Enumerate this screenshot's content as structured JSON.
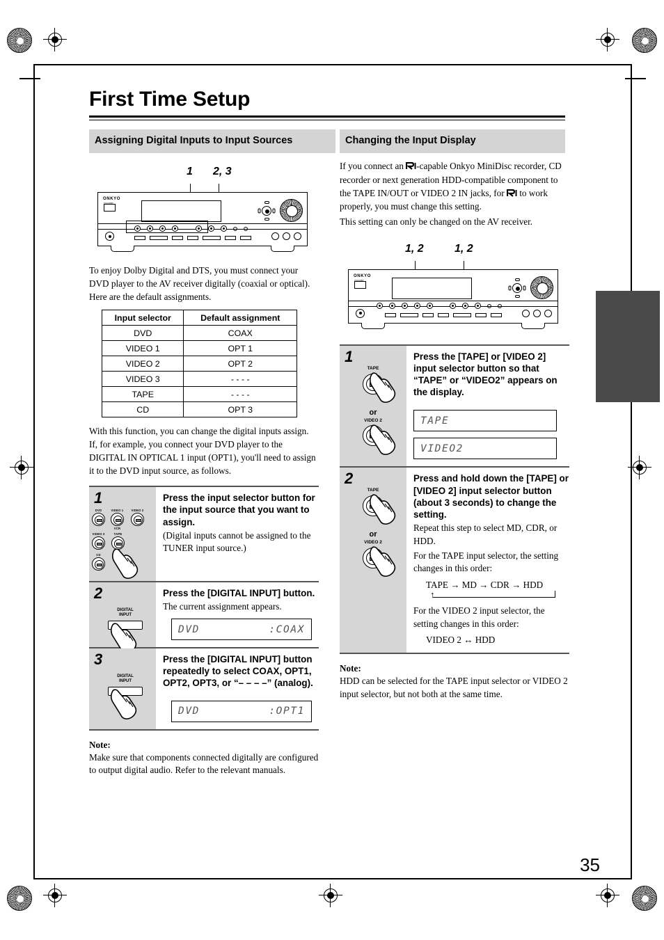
{
  "page": {
    "title": "First Time Setup",
    "page_number": "35"
  },
  "left_column": {
    "section_heading": "Assigning Digital Inputs to Input Sources",
    "diagram_callouts": [
      "1",
      "2, 3"
    ],
    "receiver_brand": "ONKYO",
    "intro_paragraph_1": "To enjoy Dolby Digital and DTS, you must connect your DVD player to the AV receiver digitally (coaxial or optical).",
    "intro_paragraph_2": "Here are the default assignments.",
    "table": {
      "headers": [
        "Input selector",
        "Default assignment"
      ],
      "rows": [
        [
          "DVD",
          "COAX"
        ],
        [
          "VIDEO 1",
          "OPT 1"
        ],
        [
          "VIDEO 2",
          "OPT 2"
        ],
        [
          "VIDEO 3",
          "- - - -"
        ],
        [
          "TAPE",
          "- - - -"
        ],
        [
          "CD",
          "OPT 3"
        ]
      ]
    },
    "after_table_paragraph": "With this function, you can change the digital inputs assign. If, for example, you connect your DVD player to the DIGITAL IN OPTICAL 1 input (OPT1), you'll need to assign it to the DVD input source, as follows.",
    "steps": [
      {
        "number": "1",
        "title": "Press the input selector button for the input source that you want to assign.",
        "description": "(Digital inputs cannot be assigned to the TUNER input source.)",
        "button_labels": [
          "DVD",
          "VIDEO 1",
          "VIDEO 2",
          "VCR",
          "VIDEO 3",
          "TAPE",
          "CD"
        ]
      },
      {
        "number": "2",
        "title": "Press the [DIGITAL INPUT] button.",
        "description": "The current assignment appears.",
        "button_label_line1": "DIGITAL",
        "button_label_line2": "INPUT",
        "lcd_left": "DVD",
        "lcd_right": ":COAX"
      },
      {
        "number": "3",
        "title": "Press the [DIGITAL INPUT] button repeatedly to select COAX, OPT1, OPT2, OPT3, or “– – – –” (analog).",
        "description": "",
        "button_label_line1": "DIGITAL",
        "button_label_line2": "INPUT",
        "lcd_left": "DVD",
        "lcd_right": ":OPT1"
      }
    ],
    "note": {
      "label": "Note:",
      "text": "Make sure that components connected digitally are configured to output digital audio. Refer to the relevant manuals."
    }
  },
  "right_column": {
    "section_heading": "Changing the Input Display",
    "intro_paragraph_1_a": "If you connect an ",
    "intro_paragraph_1_b": "-capable Onkyo MiniDisc recorder, CD recorder or next generation HDD-compatible component to the TAPE IN/OUT or VIDEO 2 IN jacks, for ",
    "intro_paragraph_1_c": " to work properly, you must change this setting.",
    "intro_paragraph_2": "This setting can only be changed on the AV receiver.",
    "diagram_callouts": [
      "1, 2",
      "1, 2"
    ],
    "receiver_brand": "ONKYO",
    "steps": [
      {
        "number": "1",
        "title": "Press the [TAPE] or [VIDEO 2] input selector button so that “TAPE” or “VIDEO2” appears on the display.",
        "button_label_1": "TAPE",
        "or_label": "or",
        "button_label_2": "VIDEO 2",
        "lcd_1": "TAPE",
        "lcd_2": "VIDEO2"
      },
      {
        "number": "2",
        "title": "Press and hold down the [TAPE] or [VIDEO 2] input selector button (about 3 seconds) to change the setting.",
        "button_label_1": "TAPE",
        "or_label": "or",
        "button_label_2": "VIDEO 2",
        "description_1": "Repeat this step to select MD, CDR, or HDD.",
        "description_2": "For the TAPE input selector, the setting changes in this order:",
        "flow_tape": "TAPE → MD → CDR → HDD",
        "description_3": "For the VIDEO 2 input selector, the setting changes in this order:",
        "flow_video2": "VIDEO 2 ↔ HDD"
      }
    ],
    "note": {
      "label": "Note:",
      "text": "HDD can be selected for the TAPE input selector or VIDEO 2 input selector, but not both at the same time."
    }
  },
  "colors": {
    "heading_background": "#d4d4d4",
    "step_panel_background": "#d6d6d6",
    "thumb_tab": "#4a4a4a",
    "lcd_text": "#555555"
  }
}
